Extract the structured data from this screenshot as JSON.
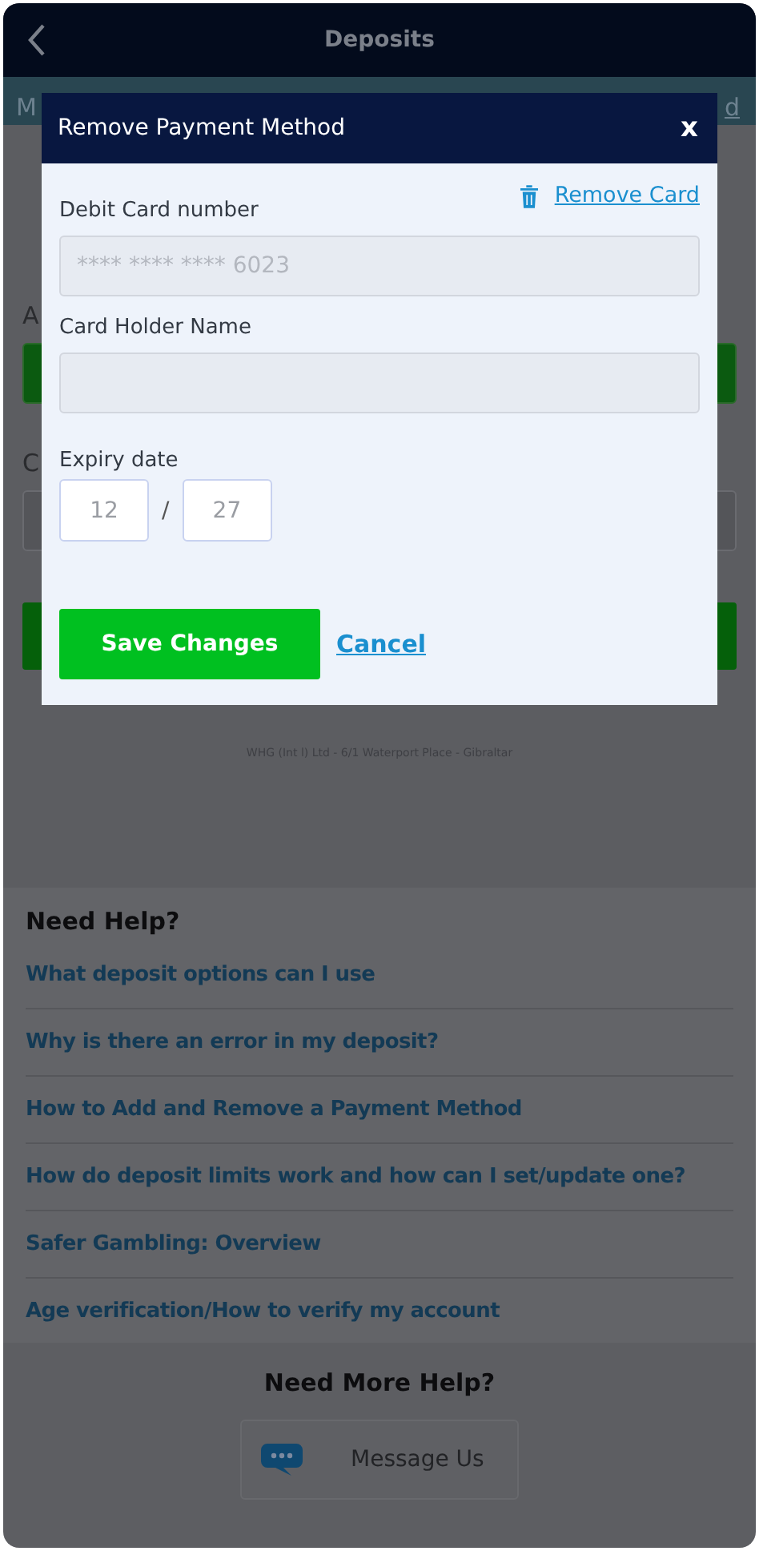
{
  "header": {
    "title": "Deposits"
  },
  "subbar": {
    "left_fragment": "M",
    "right_fragment": "d"
  },
  "background_form": {
    "label_fragments": [
      "A",
      "C"
    ],
    "footer": "WHG (Int l) Ltd - 6/1 Waterport Place - Gibraltar"
  },
  "modal": {
    "title": "Remove Payment Method",
    "close": "x",
    "remove_link": "Remove Card",
    "fields": [
      {
        "label": "Debit Card number",
        "value": "**** **** **** 6023"
      },
      {
        "label": "Card Holder Name"
      }
    ],
    "expiry": {
      "label": "Expiry date",
      "month": "12",
      "separator": "/",
      "year": "27"
    },
    "save_button": "Save Changes",
    "cancel_link": "Cancel"
  },
  "help": {
    "title": "Need Help?",
    "links": [
      "What deposit options can I use",
      "Why is there an error in my deposit?",
      "How to Add and Remove a Payment Method",
      "How do deposit limits work and how can I set/update one?",
      "Safer Gambling: Overview",
      "Age verification/How to verify my account"
    ]
  },
  "more_help": {
    "title": "Need More Help?",
    "button": "Message Us"
  }
}
